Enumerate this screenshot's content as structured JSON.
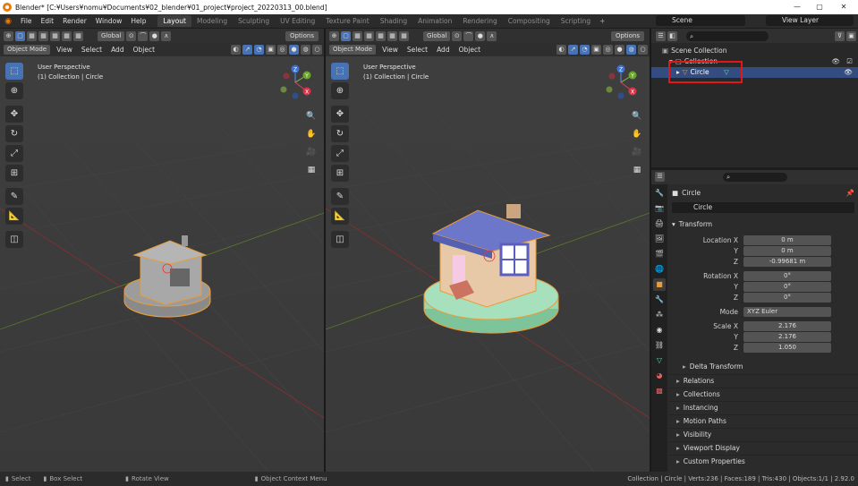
{
  "titlebar": {
    "title": "Blender* [C:¥Users¥nomu¥Documents¥02_blender¥01_project¥project_20220313_00.blend]",
    "minimize": "—",
    "maximize": "▢",
    "close": "✕"
  },
  "menus": [
    "File",
    "Edit",
    "Render",
    "Window",
    "Help"
  ],
  "workspaces": [
    "Layout",
    "Modeling",
    "Sculpting",
    "UV Editing",
    "Texture Paint",
    "Shading",
    "Animation",
    "Rendering",
    "Compositing",
    "Scripting"
  ],
  "workspace_add": "+",
  "scene": {
    "label": "Scene",
    "view_layer": "View Layer"
  },
  "viewport": {
    "orientation": "Global",
    "options": "Options",
    "mode": "Object Mode",
    "menu": [
      "View",
      "Select",
      "Add",
      "Object"
    ],
    "perspective": "User Perspective",
    "collection_info": "(1) Collection | Circle",
    "axis_x": "X",
    "axis_y": "Y",
    "axis_z": "Z"
  },
  "outliner": {
    "root": "Scene Collection",
    "collection": "Collection",
    "object": "Circle"
  },
  "properties": {
    "object_name": "Circle",
    "data_name": "Circle",
    "transform_header": "Transform",
    "location_x_label": "Location X",
    "y_label": "Y",
    "z_label": "Z",
    "location": [
      "0 m",
      "0 m",
      "-0.99681 m"
    ],
    "rotation_x_label": "Rotation X",
    "rotation": [
      "0°",
      "0°",
      "0°"
    ],
    "mode_label": "Mode",
    "mode_value": "XYZ Euler",
    "scale_x_label": "Scale X",
    "scale": [
      "2.176",
      "2.176",
      "1.050"
    ],
    "delta": "Delta Transform",
    "sections": [
      "Relations",
      "Collections",
      "Instancing",
      "Motion Paths",
      "Visibility",
      "Viewport Display",
      "Custom Properties"
    ]
  },
  "status": {
    "select": "Select",
    "box_select": "Box Select",
    "rotate_view": "Rotate View",
    "context_menu": "Object Context Menu",
    "stats": "Collection | Circle | Verts:236 | Faces:189 | Tris:430 | Objects:1/1 | 2.92.0"
  },
  "colors": {
    "accent": "#4772b3",
    "selection_outline": "#e89c3a",
    "highlight_box": "#e2171a"
  }
}
